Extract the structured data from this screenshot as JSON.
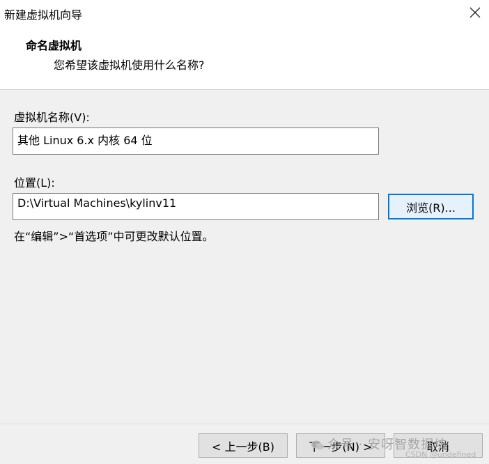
{
  "window": {
    "title": "新建虚拟机向导",
    "close_icon": "close-icon"
  },
  "header": {
    "title": "命名虚拟机",
    "subtitle": "您希望该虚拟机使用什么名称?"
  },
  "vm_name": {
    "label": "虚拟机名称(V):",
    "value": "其他 Linux 6.x 内核 64 位"
  },
  "location": {
    "label": "位置(L):",
    "value": "D:\\Virtual Machines\\kylinv11",
    "browse_label": "浏览(R)..."
  },
  "hint": "在“编辑”>“首选项”中可更改默认位置。",
  "footer": {
    "back_label": "< 上一步(B)",
    "next_label": "下一步(N) >",
    "cancel_label": "取消"
  },
  "watermark": {
    "main": "众号 · 安呀智数据坊",
    "sub": "CSDN @undefined"
  }
}
